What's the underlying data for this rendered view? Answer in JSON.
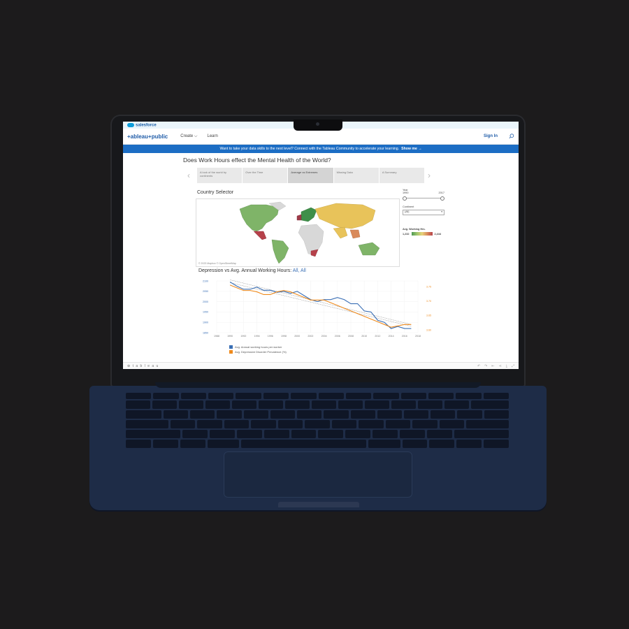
{
  "salesforce": {
    "logo": "salesforce"
  },
  "nav": {
    "brand": "+ableau+public",
    "create": "Create ⌵",
    "learn": "Learn",
    "signin": "Sign In"
  },
  "banner": {
    "text": "Want to take your data skills to the next level? Connect with the Tableau Community to accelerate your learning.",
    "link": "Show me →"
  },
  "page_title": "Does Work Hours effect the Mental Health of the World?",
  "story_points": [
    "A look of the world by continents",
    "Over the Time",
    "Average vs Extremes",
    "Missing Data",
    "A Summary"
  ],
  "country_selector": "Country Selector",
  "map_credit": "© 2023 Mapbox © OpenStreetMap",
  "filters": {
    "year_label": "Year",
    "year_min": "1990",
    "year_max": "2017",
    "continent_label": "Continent",
    "continent_value": "(All)",
    "legend_label": "Avg. Working Hrs.",
    "legend_min": "1,232",
    "legend_max": "2,444"
  },
  "line_title": "Depression vs Avg. Annual Working Hours:",
  "line_title_link": "All, All",
  "chart_data": {
    "type": "line",
    "x": [
      1988,
      1990,
      1992,
      1994,
      1996,
      1998,
      2000,
      2002,
      2004,
      2006,
      2008,
      2010,
      2012,
      2014,
      2016,
      2018
    ],
    "x_ticks": [
      "1988",
      "1990",
      "1992",
      "1994",
      "1996",
      "1998",
      "2000",
      "2002",
      "2004",
      "2006",
      "2008",
      "2010",
      "2012",
      "2014",
      "2016",
      "2018"
    ],
    "y_left_ticks": [
      "2100",
      "2050",
      "2000",
      "1950",
      "1900",
      "1850"
    ],
    "y_right_ticks": [
      "3.75",
      "3.70",
      "3.65",
      "3.60"
    ],
    "series": [
      {
        "name": "Avg. Annual working hours per worker",
        "color": "#3a6fb5",
        "axis": "left",
        "x": [
          1990,
          1991,
          1992,
          1993,
          1994,
          1995,
          1996,
          1997,
          1998,
          1999,
          2000,
          2001,
          2002,
          2003,
          2004,
          2005,
          2006,
          2007,
          2008,
          2009,
          2010,
          2011,
          2012,
          2013,
          2014,
          2015,
          2016,
          2017
        ],
        "values": [
          2095,
          2075,
          2060,
          2060,
          2070,
          2055,
          2055,
          2045,
          2050,
          2040,
          2050,
          2030,
          2010,
          2000,
          2010,
          2010,
          2020,
          2010,
          1990,
          1990,
          1955,
          1950,
          1910,
          1900,
          1870,
          1880,
          1870,
          1870
        ]
      },
      {
        "name": "Avg. Depressive Disorder Prevalence (%)",
        "color": "#ef8a1c",
        "axis": "right",
        "x": [
          1990,
          1991,
          1992,
          1993,
          1994,
          1995,
          1996,
          1997,
          1998,
          1999,
          2000,
          2001,
          2002,
          2003,
          2004,
          2005,
          2006,
          2007,
          2008,
          2009,
          2010,
          2011,
          2012,
          2013,
          2014,
          2015,
          2016,
          2017
        ],
        "values": [
          3.755,
          3.745,
          3.735,
          3.735,
          3.73,
          3.72,
          3.72,
          3.73,
          3.735,
          3.73,
          3.72,
          3.71,
          3.7,
          3.7,
          3.7,
          3.69,
          3.68,
          3.67,
          3.66,
          3.65,
          3.64,
          3.63,
          3.62,
          3.61,
          3.6,
          3.605,
          3.61,
          3.61
        ]
      }
    ],
    "ylim_left": [
      1850,
      2100
    ],
    "ylim_right": [
      3.58,
      3.77
    ],
    "trendlines": true,
    "grid": true
  },
  "footer": {
    "logo": "⊕ t a b l e a u"
  }
}
